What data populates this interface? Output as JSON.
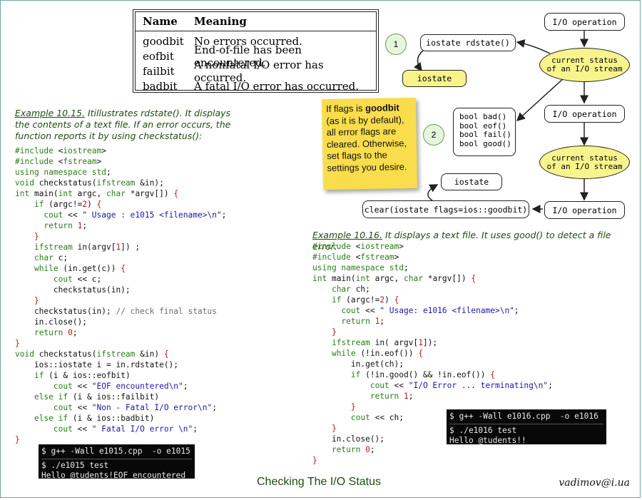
{
  "flag_table": {
    "headers": [
      "Name",
      "Meaning"
    ],
    "rows": [
      [
        "goodbit",
        "No errors occurred."
      ],
      [
        "eofbit",
        "End-of-file has been encountered."
      ],
      [
        "failbit",
        "A nonfatal I/O error has occurred."
      ],
      [
        "badbit",
        "A fatal I/O error has occurred."
      ]
    ]
  },
  "diagram": {
    "io_operation": "I/O operation",
    "current_status_line1": "current status",
    "current_status_line2": "of an I/O stream",
    "rdstate": "iostate rdstate()",
    "iostate": "iostate",
    "step1": "1",
    "step2": "2",
    "bool_funcs": [
      "bool bad()",
      "bool eof()",
      "bool fail()",
      "bool good()"
    ],
    "clear": "clear(iostate flags=ios::goodbit)"
  },
  "note": {
    "part1": "If flags is ",
    "bold": "goodbit",
    "part2": " (as it is by default), all error flags are cleared. Otherwise, set flags to the settings you desire."
  },
  "example1": {
    "label": "Example 10.15.",
    "text": " Itillustrates rdstate(). It displays the contents of a text file. If an error occurs, the function reports it by using checkstatus():",
    "terminal": [
      "$ g++ -Wall e1015.cpp  -o e1015",
      "$ ./e1015 test",
      "Hello @tudents!EOF encountered"
    ]
  },
  "example2": {
    "label": "Example 10.16.",
    "text": " It displays a text file. It uses good() to detect a file error:",
    "terminal": [
      "$ g++ -Wall e1016.cpp  -o e1016",
      "$ ./e1016 test",
      "Hello @tudents!!"
    ]
  },
  "footer": {
    "title": "Checking The I/O Status",
    "author": "vadimov@i.ua"
  }
}
